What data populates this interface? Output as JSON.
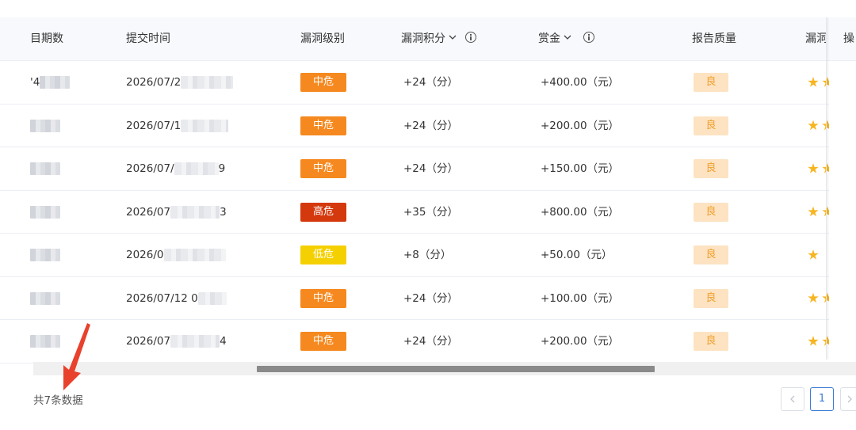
{
  "table": {
    "headers": {
      "period": "目期数",
      "submit_time": "提交时间",
      "level": "漏洞级别",
      "points": "漏洞积分",
      "bounty": "赏金",
      "quality": "报告质量",
      "vuln_partial": "漏洞",
      "op_partial": "操"
    },
    "rows": [
      {
        "id_partial": "'4",
        "time": "2026/07/2",
        "time_tail": "",
        "level": "中危",
        "level_color": "#f5891f",
        "points": "+24（分）",
        "bounty": "+400.00（元）",
        "quality": "良",
        "stars": 2
      },
      {
        "id_partial": "",
        "time": "2026/07/1",
        "time_tail": "",
        "level": "中危",
        "level_color": "#f5891f",
        "points": "+24（分）",
        "bounty": "+200.00（元）",
        "quality": "良",
        "stars": 2
      },
      {
        "id_partial": "",
        "time": "2026/07/",
        "time_tail": "9",
        "level": "中危",
        "level_color": "#f5891f",
        "points": "+24（分）",
        "bounty": "+150.00（元）",
        "quality": "良",
        "stars": 2
      },
      {
        "id_partial": "",
        "time": "2026/07",
        "time_tail": "3",
        "level": "高危",
        "level_color": "#d4380d",
        "points": "+35（分）",
        "bounty": "+800.00（元）",
        "quality": "良",
        "stars": 2
      },
      {
        "id_partial": "",
        "time": "2026/0",
        "time_tail": "",
        "level": "低危",
        "level_color": "#f5d000",
        "points": "+8（分）",
        "bounty": "+50.00（元）",
        "quality": "良",
        "stars": 1
      },
      {
        "id_partial": "",
        "time": "2026/07/12 0",
        "time_tail": "",
        "level": "中危",
        "level_color": "#f5891f",
        "points": "+24（分）",
        "bounty": "+100.00（元）",
        "quality": "良",
        "stars": 2
      },
      {
        "id_partial": "",
        "time": "2026/07",
        "time_tail": "4",
        "level": "中危",
        "level_color": "#f5891f",
        "points": "+24（分）",
        "bounty": "+200.00（元）",
        "quality": "良",
        "stars": 2
      }
    ]
  },
  "footer": {
    "total": "共7条数据",
    "page": "1",
    "prev_icon": "chevron-left-icon",
    "next_icon": "chevron-right-icon",
    "arrow_color": "#e8412c"
  }
}
